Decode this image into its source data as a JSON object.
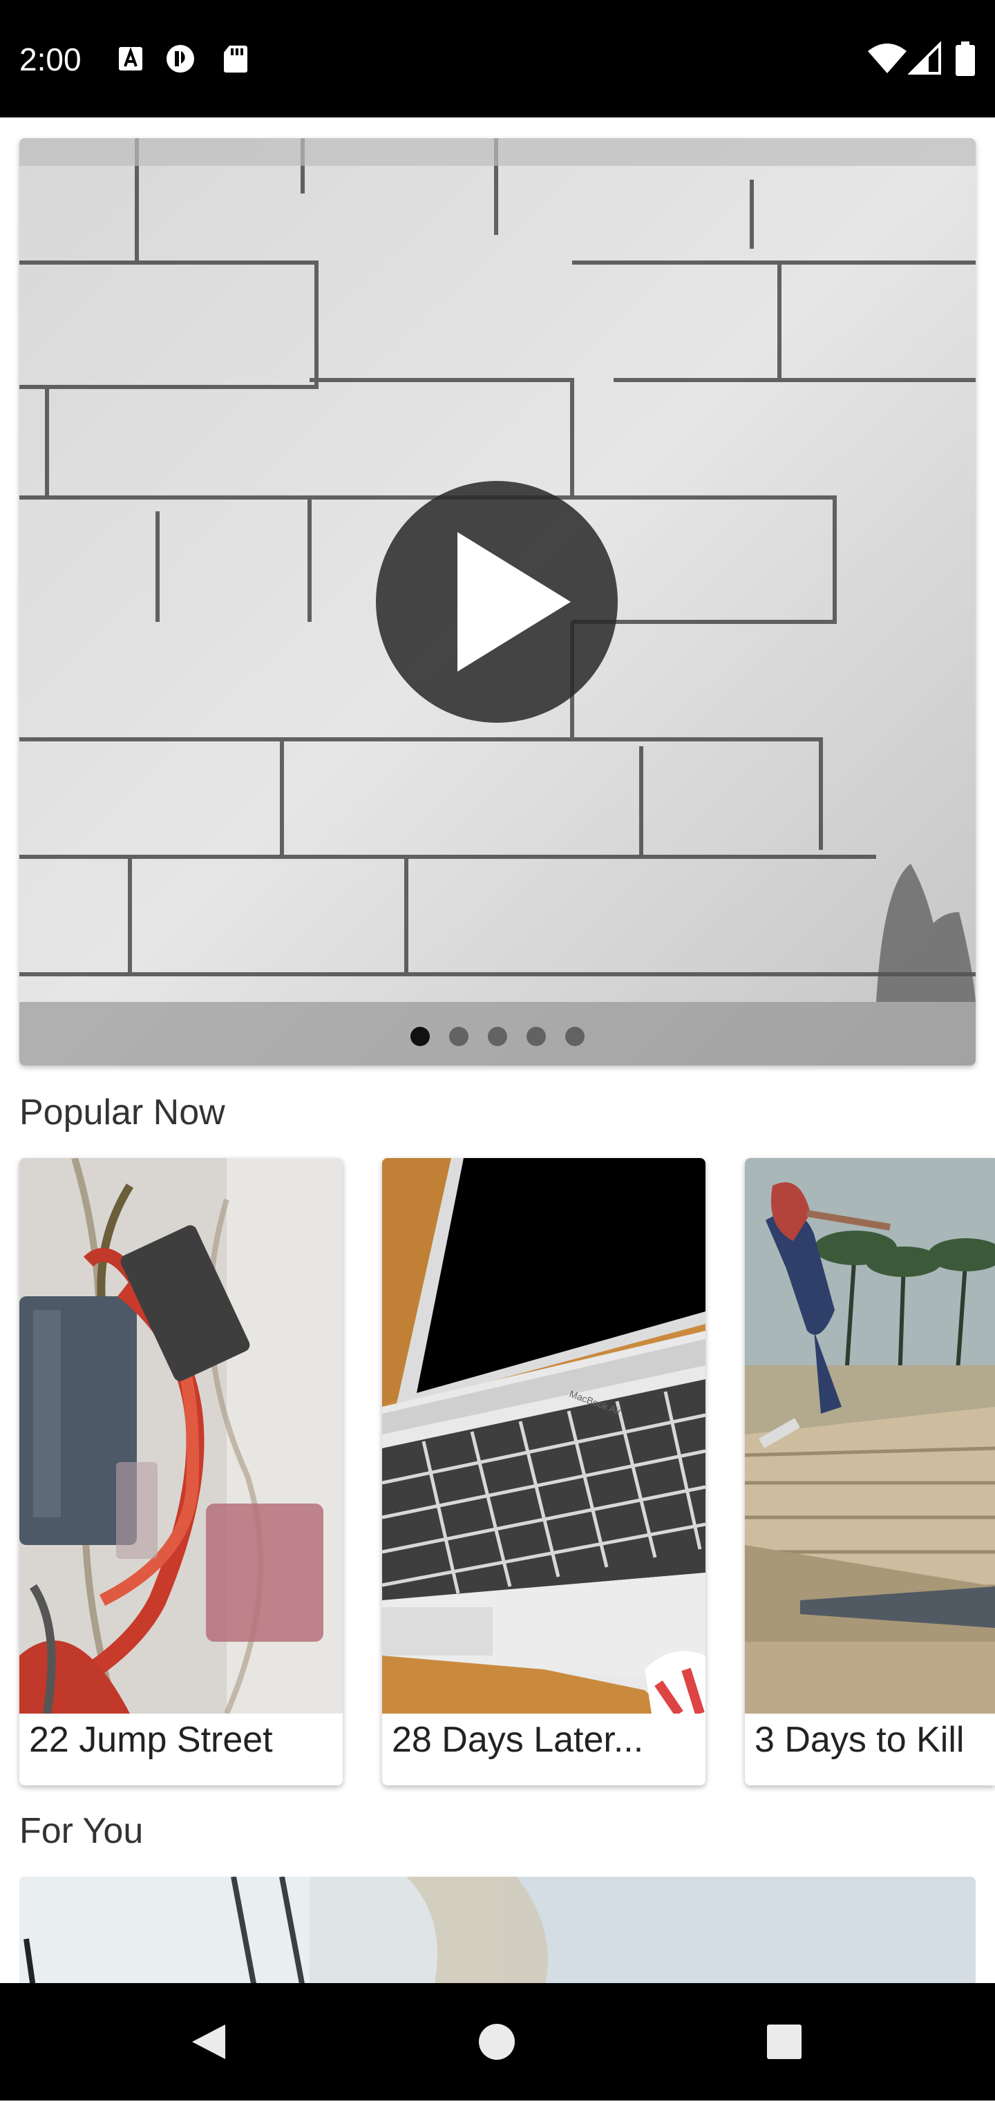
{
  "status_bar": {
    "time": "2:00",
    "left_icons": [
      "text-a-icon",
      "spiral-icon",
      "sd-card-icon"
    ],
    "right_icons": [
      "wifi-icon",
      "signal-icon",
      "battery-icon"
    ]
  },
  "hero": {
    "slide_count": 5,
    "active_slide": 1,
    "play_icon": "play-icon"
  },
  "sections": {
    "popular_title": "Popular Now",
    "foryou_title": "For You"
  },
  "popular": [
    {
      "title": "22 Jump Street"
    },
    {
      "title": "28 Days Later..."
    },
    {
      "title": "3 Days to Kill"
    }
  ],
  "laptop_brand": "MacBook Air",
  "nav": {
    "back": "back-icon",
    "home": "home-icon",
    "recents": "recents-icon"
  },
  "colors": {
    "status_bar": "#000000",
    "nav_bar": "#000000",
    "background": "#ffffff",
    "section_title": "#333333"
  }
}
